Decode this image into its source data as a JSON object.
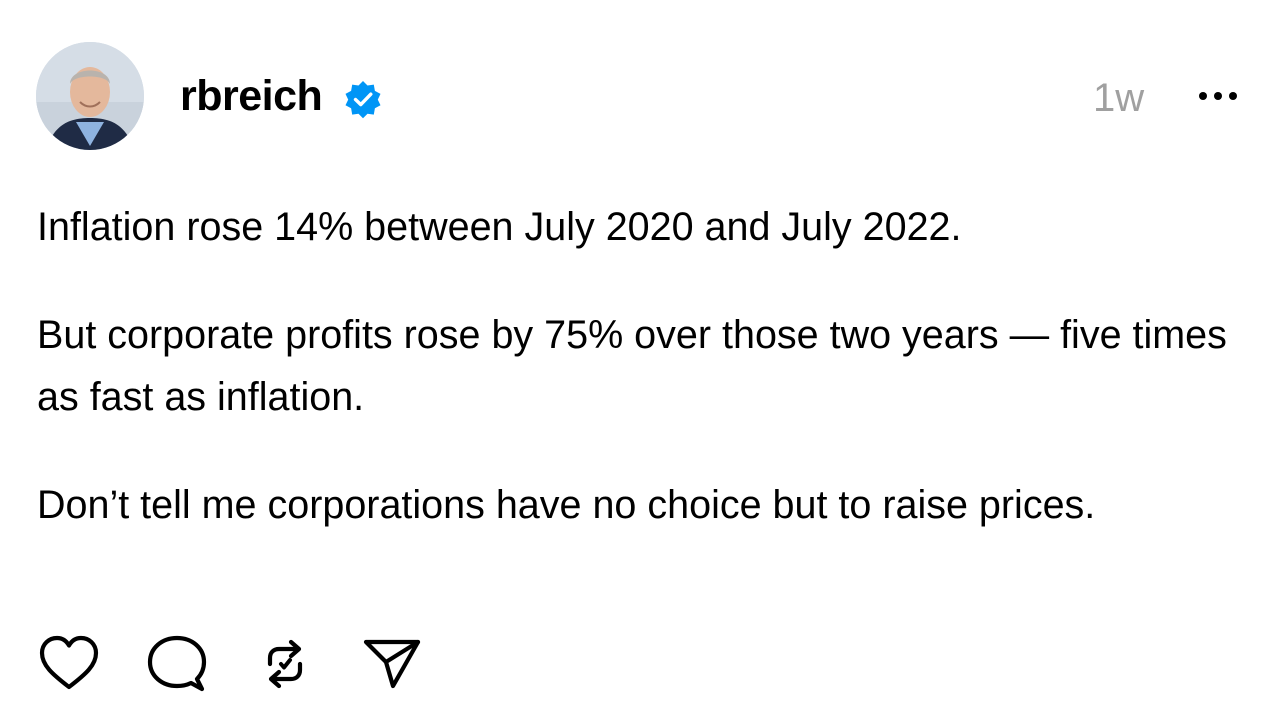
{
  "post": {
    "username": "rbreich",
    "verified": true,
    "timestamp": "1w",
    "paragraphs": [
      "Inflation rose 14% between July 2020 and July 2022.",
      "But corporate profits rose by 75% over those two years — five times as fast as inflation.",
      "Don’t tell me corporations have no choice but to raise prices."
    ]
  },
  "icons": {
    "verified": "verified-badge-icon",
    "more": "more-horizontal-icon",
    "like": "heart-icon",
    "reply": "comment-bubble-icon",
    "repost": "repost-icon",
    "share": "send-paper-plane-icon"
  },
  "colors": {
    "verified_blue": "#0095f6",
    "timestamp_gray": "#a0a0a0",
    "text": "#000000"
  }
}
